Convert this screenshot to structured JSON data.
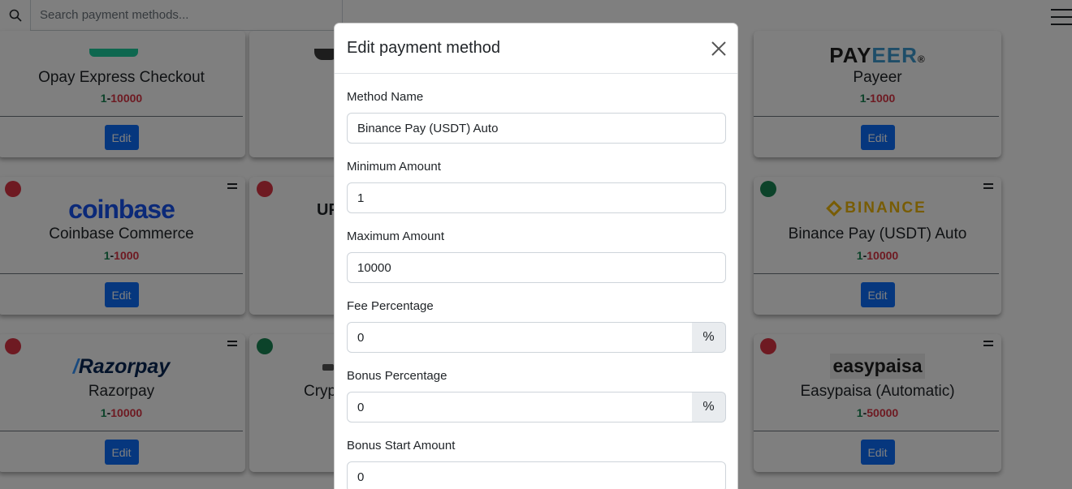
{
  "search": {
    "placeholder": "Search payment methods..."
  },
  "cards": [
    {
      "name": "Opay Express Checkout",
      "min": "1",
      "max": "10000",
      "edit": "Edit"
    },
    {
      "name": "Payeer",
      "min": "1",
      "max": "1000",
      "edit": "Edit"
    },
    {
      "name": "Coinbase Commerce",
      "logo": "coinbase",
      "min": "1",
      "max": "1000",
      "edit": "Edit",
      "status": "inactive"
    },
    {
      "name_fragment": "UP",
      "status": "inactive"
    },
    {
      "name": "Binance Pay (USDT) Auto",
      "logo": "BINANCE",
      "min": "1",
      "max": "10000",
      "edit": "Edit",
      "status": "active"
    },
    {
      "name": "Razorpay",
      "logo": "Razorpay",
      "min": "1",
      "max": "10000",
      "edit": "Edit",
      "status": "inactive"
    },
    {
      "name_fragment": "Cryp",
      "status": "active"
    },
    {
      "name": "Easypaisa (Automatic)",
      "logo": "easypaisa",
      "min": "1",
      "max": "50000",
      "edit": "Edit",
      "status": "inactive"
    }
  ],
  "modal": {
    "title": "Edit payment method",
    "fields": [
      {
        "label": "Method Name",
        "value": "Binance Pay (USDT) Auto"
      },
      {
        "label": "Minimum Amount",
        "value": "1"
      },
      {
        "label": "Maximum Amount",
        "value": "10000"
      },
      {
        "label": "Fee Percentage",
        "value": "0",
        "addon": "%"
      },
      {
        "label": "Bonus Percentage",
        "value": "0",
        "addon": "%"
      },
      {
        "label": "Bonus Start Amount",
        "value": "0"
      }
    ]
  },
  "colors": {
    "primary": "#0d6efd",
    "success": "#198754",
    "danger": "#dc3545",
    "binance": "#f0b90b",
    "coinbase": "#1652f0",
    "razorpay": "#072654"
  }
}
